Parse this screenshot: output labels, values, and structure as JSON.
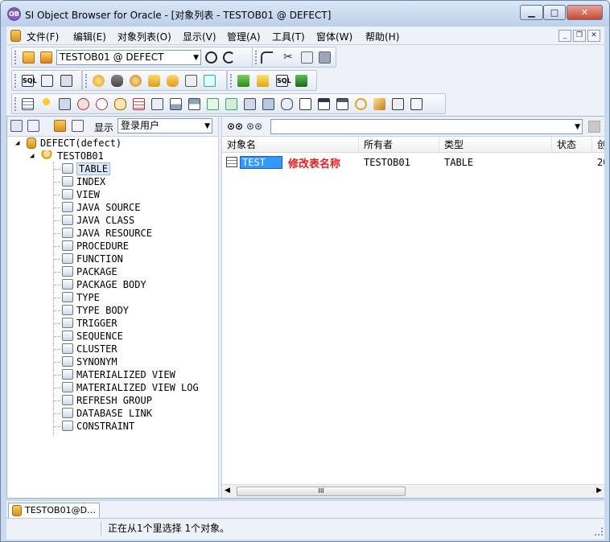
{
  "window": {
    "title": "SI Object Browser for Oracle - [对象列表 - TESTOB01 @ DEFECT]",
    "app_icon_text": "OB",
    "min_glyph": "▁",
    "max_glyph": "□",
    "close_glyph": "✕"
  },
  "menu": {
    "items": [
      "文件(F)",
      "编辑(E)",
      "对象列表(O)",
      "显示(V)",
      "管理(A)",
      "工具(T)",
      "窗体(W)",
      "帮助(H)"
    ],
    "mdi_min": "_",
    "mdi_restore": "❐",
    "mdi_close": "✕"
  },
  "toolbar": {
    "connection": "TESTOB01 @ DEFECT"
  },
  "left_panel": {
    "show_label": "显示",
    "show_value": "登录用户"
  },
  "tree": {
    "root": "DEFECT(defect)",
    "user": "TESTOB01",
    "items": [
      "TABLE",
      "INDEX",
      "VIEW",
      "JAVA SOURCE",
      "JAVA CLASS",
      "JAVA RESOURCE",
      "PROCEDURE",
      "FUNCTION",
      "PACKAGE",
      "PACKAGE BODY",
      "TYPE",
      "TYPE BODY",
      "TRIGGER",
      "SEQUENCE",
      "CLUSTER",
      "SYNONYM",
      "MATERIALIZED VIEW",
      "MATERIALIZED VIEW LOG",
      "REFRESH GROUP",
      "DATABASE LINK",
      "CONSTRAINT"
    ]
  },
  "grid": {
    "columns": [
      "对象名",
      "所有者",
      "类型",
      "状态",
      "创"
    ],
    "row": {
      "name": "TEST",
      "owner": "TESTOB01",
      "type": "TABLE",
      "created": "20"
    },
    "annotation": "修改表名称",
    "scroll_mid": "III"
  },
  "status": {
    "tab_label": "TESTOB01@D…",
    "message": "正在从1个里选择 1个对象。"
  },
  "colors": {
    "accent": "#3399ff",
    "annotation": "#e81e1e",
    "titlebar": "#c9d9ef"
  }
}
